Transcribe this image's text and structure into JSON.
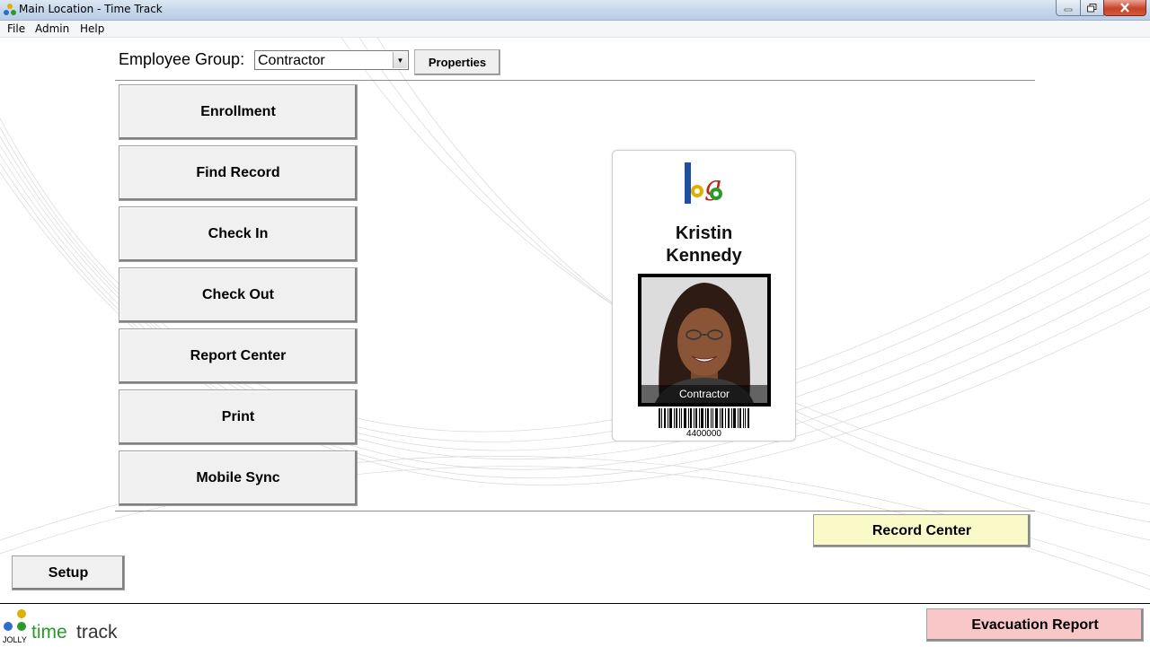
{
  "window": {
    "title": "Main Location - Time Track",
    "controls": {
      "minimize": "minimize-icon",
      "maximize": "restore-icon",
      "close": "close-icon"
    }
  },
  "menu": {
    "items": [
      "File",
      "Admin",
      "Help"
    ]
  },
  "toolbar": {
    "employee_group_label": "Employee Group:",
    "employee_group_value": "Contractor",
    "properties_label": "Properties"
  },
  "nav": {
    "buttons": [
      "Enrollment",
      "Find Record",
      "Check In",
      "Check Out",
      "Report Center",
      "Print",
      "Mobile Sync"
    ]
  },
  "badge": {
    "first_name": "Kristin",
    "last_name": "Kennedy",
    "photo_caption": "Contractor",
    "barcode_number": "4400000"
  },
  "actions": {
    "record_center": "Record Center",
    "setup": "Setup",
    "evacuation_report": "Evacuation Report"
  },
  "brand": {
    "jolly": "JOLLY",
    "time": "time",
    "track": "track"
  },
  "colors": {
    "record_center_bg": "#fafac8",
    "evacuation_bg": "#f9c7c7",
    "brand_green": "#2a9a2a"
  }
}
